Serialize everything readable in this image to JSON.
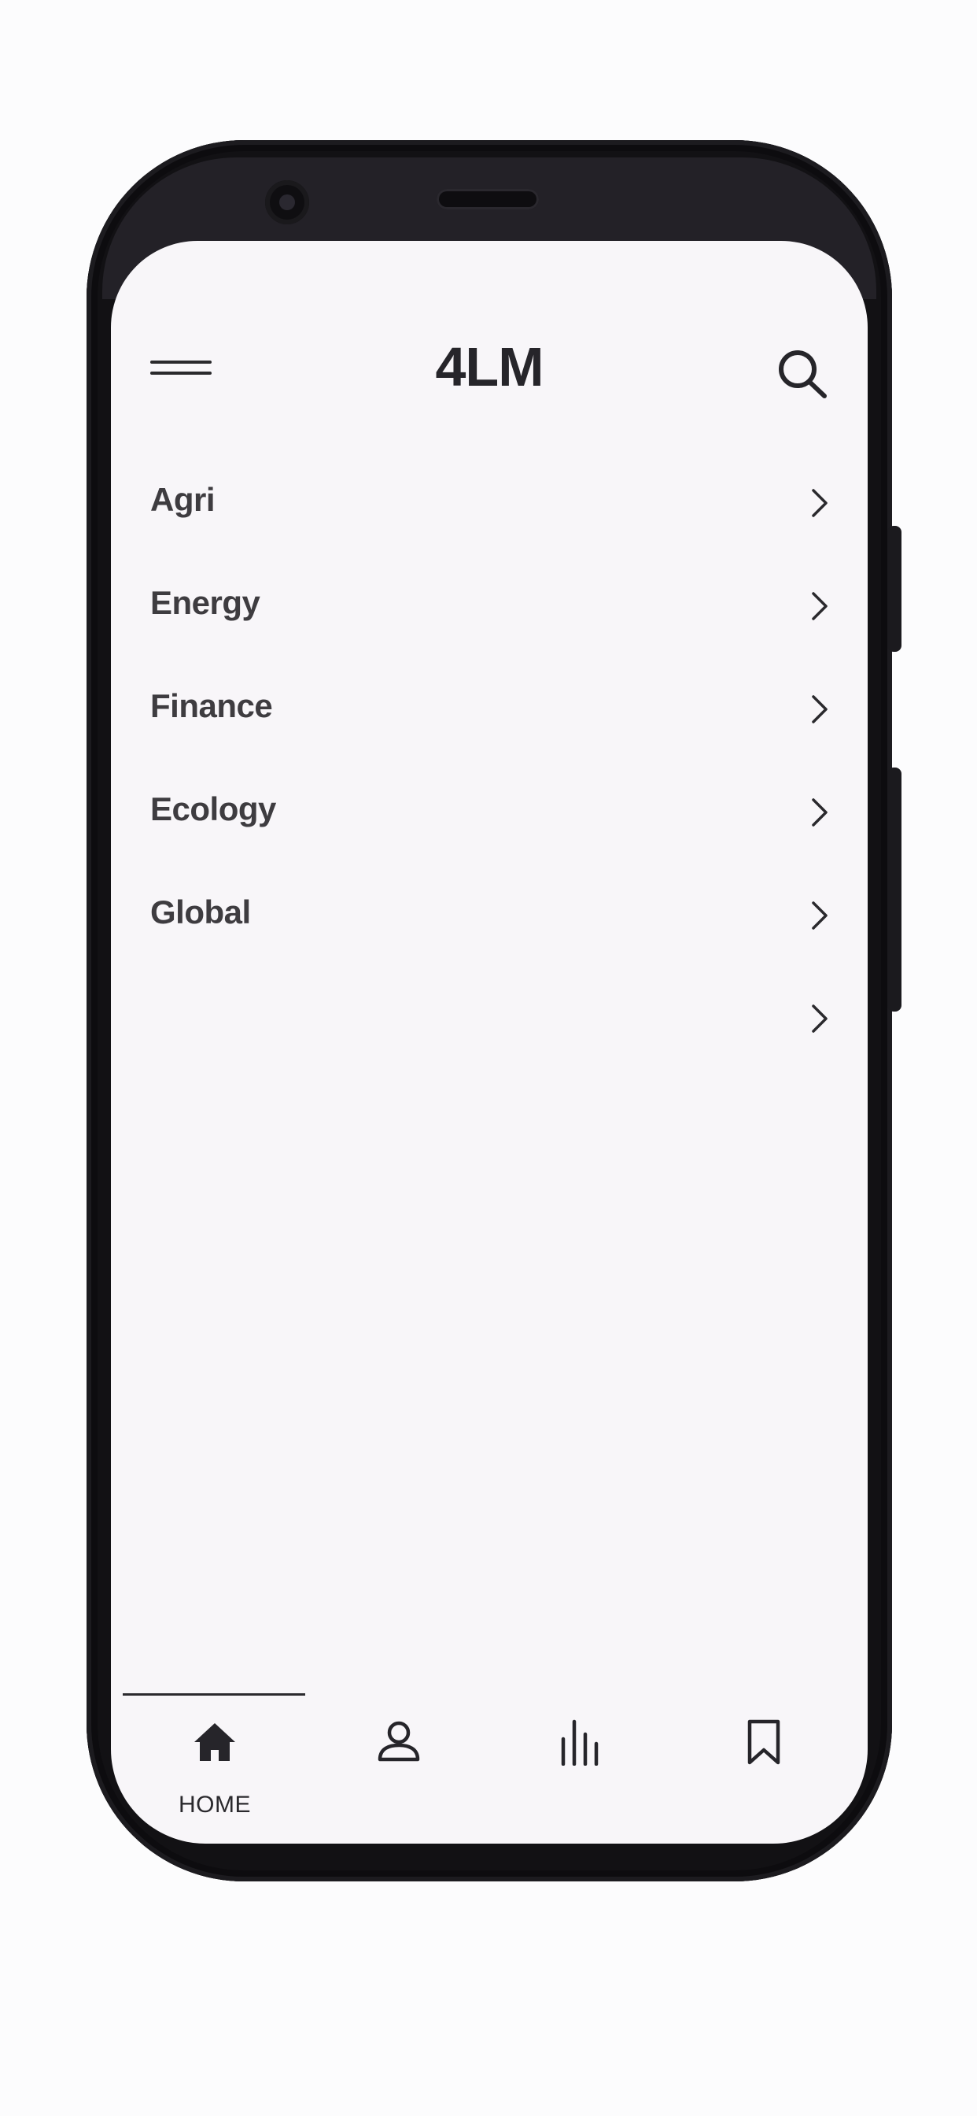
{
  "app": {
    "title": "4LM"
  },
  "header": {
    "menu_icon": "hamburger-menu-icon",
    "search_icon": "search-icon"
  },
  "categories": [
    {
      "label": "Agri",
      "icon": "chevron-right-icon"
    },
    {
      "label": "Energy",
      "icon": "chevron-right-icon"
    },
    {
      "label": "Finance",
      "icon": "chevron-right-icon"
    },
    {
      "label": "Ecology",
      "icon": "chevron-right-icon"
    },
    {
      "label": "Global",
      "icon": "chevron-right-icon"
    },
    {
      "label": "",
      "icon": "chevron-right-icon"
    }
  ],
  "bottom_nav": {
    "active_tab": "home",
    "tabs": [
      {
        "id": "home",
        "label": "HOME",
        "icon": "home-icon"
      },
      {
        "id": "profile",
        "label": "",
        "icon": "user-icon"
      },
      {
        "id": "stats",
        "label": "",
        "icon": "bar-chart-icon"
      },
      {
        "id": "saved",
        "label": "",
        "icon": "bookmark-icon"
      }
    ]
  },
  "colors": {
    "screen_background": "#f8f6f9",
    "text_primary": "#26252a",
    "text_list": "#3e3c40",
    "device_frame": "#121114"
  }
}
